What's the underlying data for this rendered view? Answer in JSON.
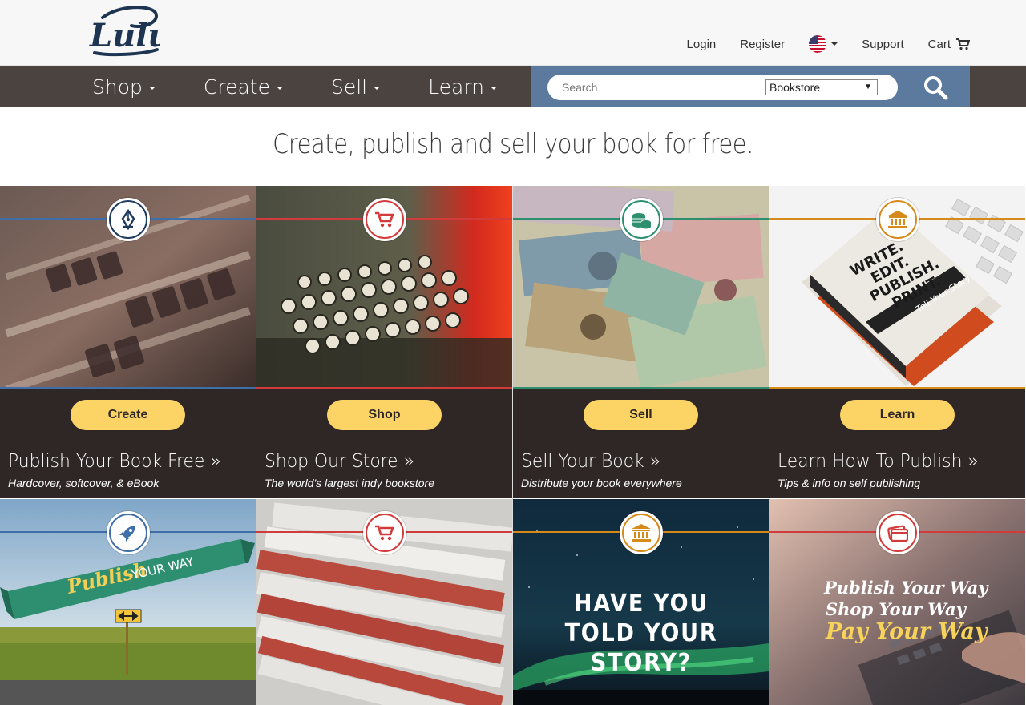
{
  "header": {
    "logo_text": "Lulu",
    "links": {
      "login": "Login",
      "register": "Register",
      "support": "Support",
      "cart": "Cart"
    }
  },
  "nav": {
    "items": [
      {
        "label": "Shop"
      },
      {
        "label": "Create"
      },
      {
        "label": "Sell"
      },
      {
        "label": "Learn"
      }
    ],
    "search": {
      "placeholder": "Search",
      "scope": "Bookstore"
    }
  },
  "hero": {
    "tagline": "Create, publish and sell your book for free."
  },
  "tiles": [
    {
      "button": "Create",
      "title": "Publish Your Book Free »",
      "subtitle": "Hardcover, softcover, & eBook",
      "accent": "#1f3a5f",
      "icon": "pen-nib-icon"
    },
    {
      "button": "Shop",
      "title": "Shop Our Store »",
      "subtitle": "The world's largest indy bookstore",
      "accent": "#d23b3b",
      "icon": "cart-icon"
    },
    {
      "button": "Sell",
      "title": "Sell Your Book »",
      "subtitle": "Distribute your book everywhere",
      "accent": "#2e8f6f",
      "icon": "coins-icon"
    },
    {
      "button": "Learn",
      "title": "Learn How To Publish »",
      "subtitle": "Tips & info on self publishing",
      "accent": "#d68a1a",
      "icon": "bank-icon"
    }
  ],
  "promo": [
    {
      "icon": "rocket-icon",
      "accent": "#3f6fa8",
      "banner_word1": "Publish",
      "banner_word2": "YOUR WAY"
    },
    {
      "icon": "cart-icon",
      "accent": "#d23b3b"
    },
    {
      "icon": "bank-icon",
      "accent": "#d68a1a",
      "headline": "HAVE YOU TOLD YOUR STORY?"
    },
    {
      "icon": "credit-card-icon",
      "accent": "#d23b3b",
      "line1": "Publish Your Way",
      "line2": "Shop Your Way",
      "line3": "Pay Your Way"
    }
  ],
  "book_cover": {
    "line1": "WRITE.",
    "line2": "EDIT.",
    "line3": "PUBLISH.",
    "line4": "PRINT.",
    "tag": "Tell Your Story"
  },
  "colors": {
    "nav_bg": "#4a4340",
    "search_bg": "#5b7a9e",
    "button_yellow": "#fcd465",
    "tile_footer": "#2e2726"
  }
}
